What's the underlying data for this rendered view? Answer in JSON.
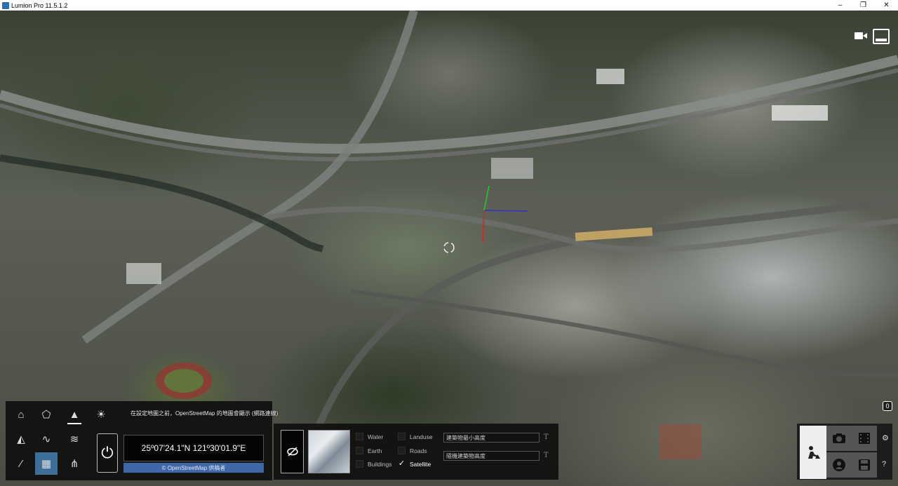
{
  "window": {
    "title": "Lumion Pro 11.5.1.2",
    "minimize": "–",
    "restore": "❐",
    "close": "✕"
  },
  "viewport": {
    "counter_badge": "0"
  },
  "landscape_panel": {
    "osm_notice": "在設定地圖之前，OpenStreetMap 的地圖會顯示 (網路連線)",
    "coordinates": "25º07'24.1\"N 121º30'01.9\"E",
    "osm_credit": "© OpenStreetMap 供稿者",
    "tools_row1": [
      "home-icon",
      "paint-icon",
      "mountain-icon",
      "sun-icon"
    ],
    "tools_row2": [
      "terrain-icon",
      "water-wave-icon",
      "ocean-icon"
    ],
    "tools_row3": [
      "brush-icon",
      "openstreetmap-icon",
      "grass-icon"
    ]
  },
  "layers_panel": {
    "layers": [
      {
        "label": "Water",
        "checked": false
      },
      {
        "label": "Earth",
        "checked": false
      },
      {
        "label": "Buildings",
        "checked": false
      },
      {
        "label": "Landuse",
        "checked": false
      },
      {
        "label": "Roads",
        "checked": false
      },
      {
        "label": "Satellite",
        "checked": true
      }
    ],
    "field1": "建築物最小高度",
    "field2": "隨機建築物高度"
  },
  "mode_panel": {
    "buttons": [
      "build-mode-icon",
      "camera-icon",
      "movie-icon",
      "360-panorama-icon",
      "save-icon"
    ],
    "side": [
      "settings-icon",
      "help-icon"
    ]
  },
  "colors": {
    "accent": "#3d6f98",
    "osm_bar": "#3e68a8"
  }
}
